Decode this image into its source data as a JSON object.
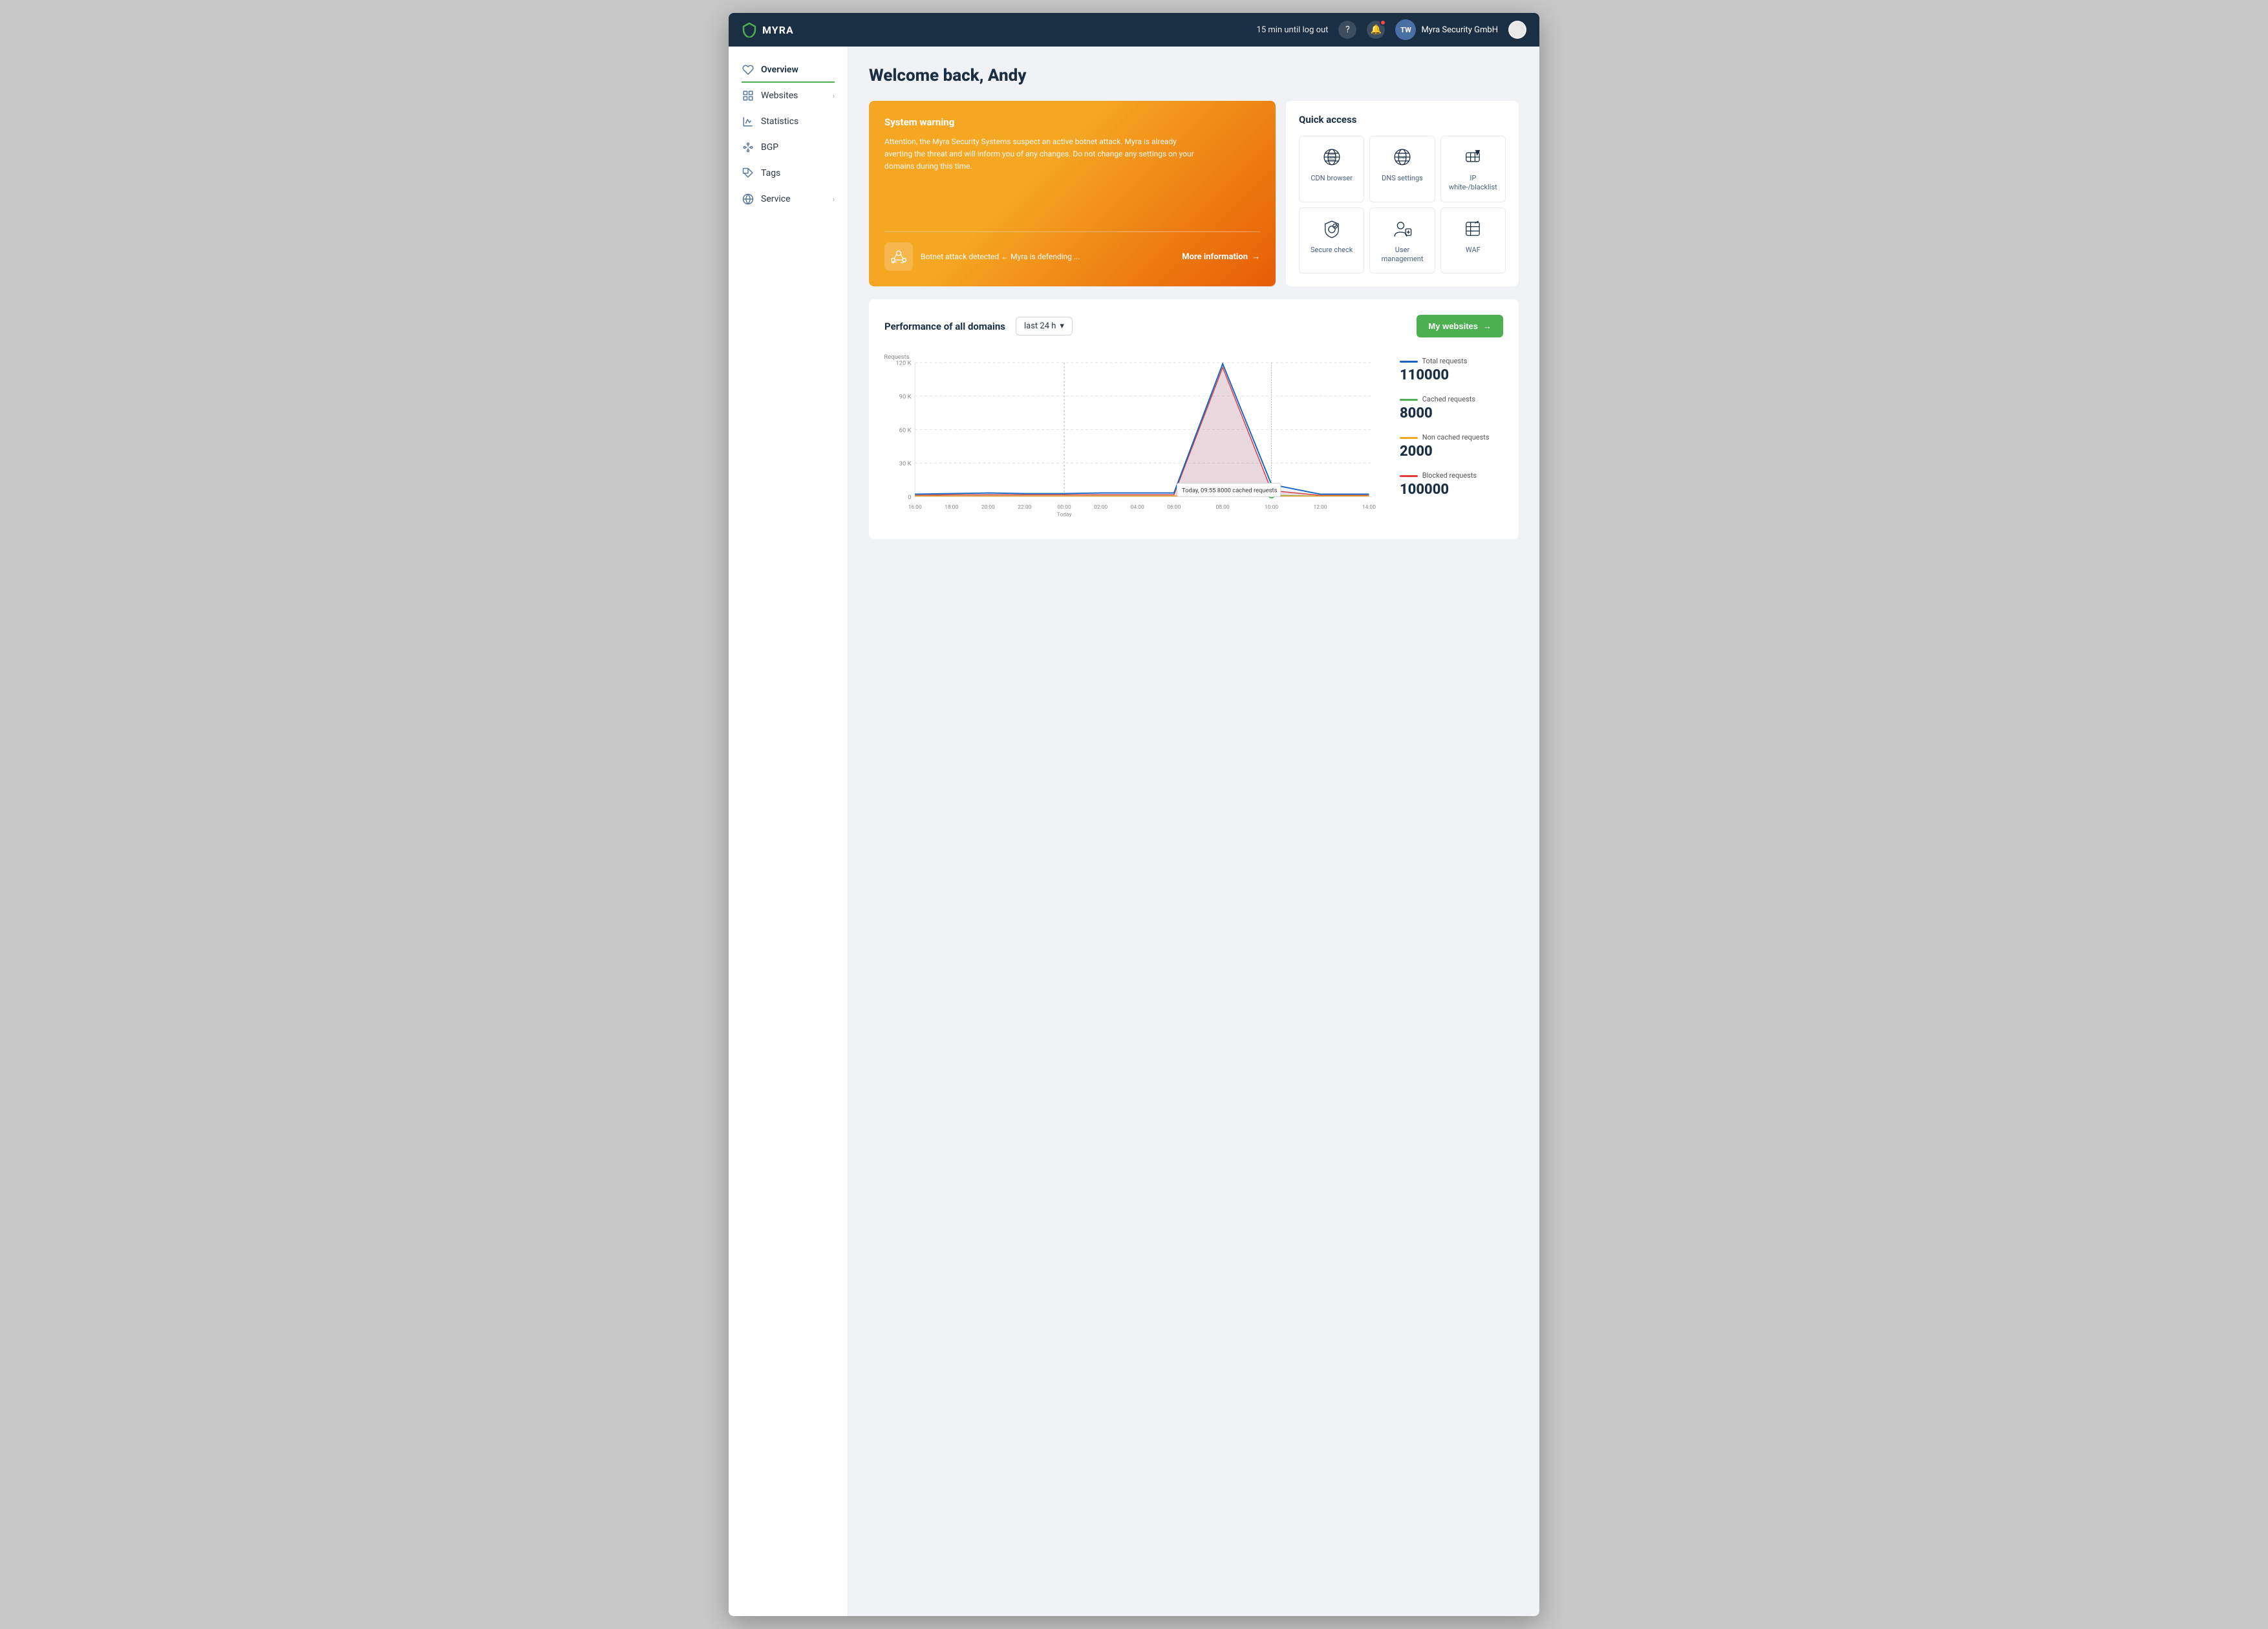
{
  "topbar": {
    "logo_text": "MYRA",
    "session_text": "15 min until log out",
    "help_icon": "?",
    "user_company": "Myra Security GmbH",
    "user_initials": "TW"
  },
  "sidebar": {
    "items": [
      {
        "id": "overview",
        "label": "Overview",
        "icon": "heart-icon",
        "active": true,
        "has_arrow": false
      },
      {
        "id": "websites",
        "label": "Websites",
        "icon": "grid-icon",
        "active": false,
        "has_arrow": true
      },
      {
        "id": "statistics",
        "label": "Statistics",
        "icon": "chart-icon",
        "active": false,
        "has_arrow": false
      },
      {
        "id": "bgp",
        "label": "BGP",
        "icon": "nodes-icon",
        "active": false,
        "has_arrow": false
      },
      {
        "id": "tags",
        "label": "Tags",
        "icon": "tag-icon",
        "active": false,
        "has_arrow": false
      },
      {
        "id": "service",
        "label": "Service",
        "icon": "globe-icon",
        "active": false,
        "has_arrow": true
      }
    ]
  },
  "page": {
    "welcome_text": "Welcome back, Andy"
  },
  "warning_panel": {
    "title": "System warning",
    "text": "Attention, the Myra Security Systems suspect an active botnet attack. Myra is already averting the threat and will inform you of any changes. Do not change any settings on your domains during this time.",
    "bottom_text": "Botnet attack detected ← Myra is defending ...",
    "more_info_label": "More information",
    "more_info_arrow": "→"
  },
  "quick_access": {
    "title": "Quick access",
    "items": [
      {
        "id": "cdn-browser",
        "label": "CDN browser",
        "icon": "cdn-icon"
      },
      {
        "id": "dns-settings",
        "label": "DNS settings",
        "icon": "dns-icon"
      },
      {
        "id": "ip-whitelist",
        "label": "IP white-/blacklist",
        "icon": "ip-icon"
      },
      {
        "id": "secure-check",
        "label": "Secure check",
        "icon": "shield-icon"
      },
      {
        "id": "user-management",
        "label": "User management",
        "icon": "user-mgmt-icon"
      },
      {
        "id": "waf",
        "label": "WAF",
        "icon": "waf-icon"
      }
    ]
  },
  "performance": {
    "title": "Performance of all domains",
    "time_selector_label": "last 24 h",
    "my_websites_label": "My websites",
    "y_axis_label": "Requests",
    "y_ticks": [
      "120 K",
      "90 K",
      "60 K",
      "30 K",
      "0"
    ],
    "x_ticks": [
      "16:00",
      "18:00",
      "20:00",
      "22:00",
      "00:00\nToday",
      "02:00",
      "04:00",
      "06:00",
      "08:00",
      "10:00",
      "12:00",
      "14:00"
    ],
    "tooltip": {
      "text": "Today, 09:55  8000 cached requests"
    },
    "stats": [
      {
        "id": "total",
        "label": "Total requests",
        "value": "110000",
        "color": "#1565c0"
      },
      {
        "id": "cached",
        "label": "Cached requests",
        "value": "8000",
        "color": "#4caf50"
      },
      {
        "id": "non-cached",
        "label": "Non cached requests",
        "value": "2000",
        "color": "#f5a623"
      },
      {
        "id": "blocked",
        "label": "Blocked requests",
        "value": "100000",
        "color": "#e53935"
      }
    ]
  }
}
